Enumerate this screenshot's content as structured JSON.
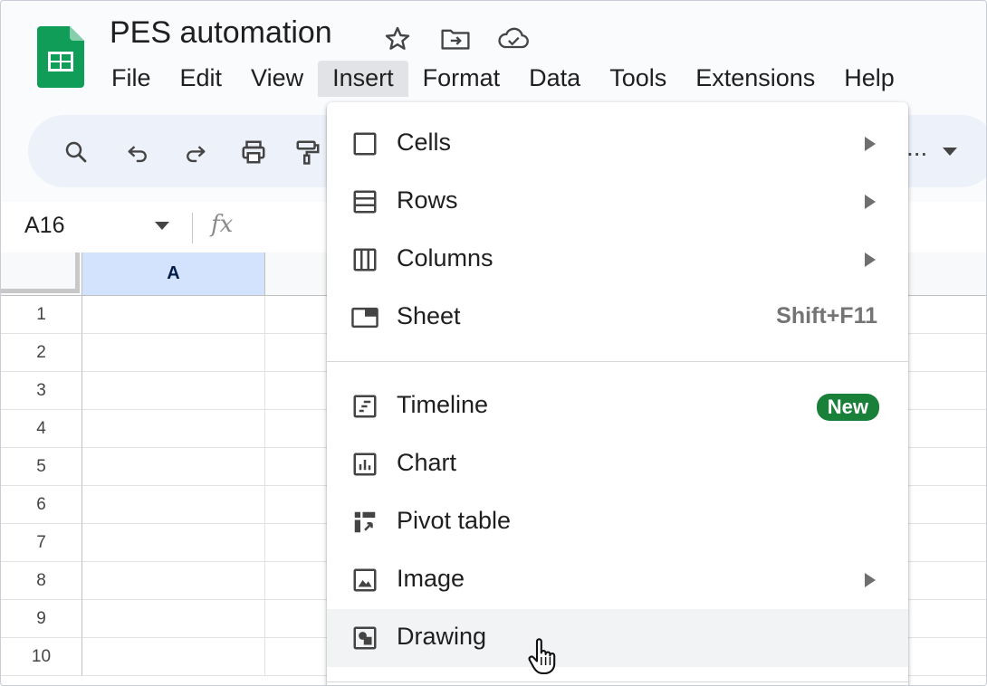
{
  "header": {
    "title": "PES automation",
    "icons": [
      "star-icon",
      "move-to-folder-icon",
      "cloud-saved-icon"
    ]
  },
  "menubar": {
    "items": [
      {
        "label": "File"
      },
      {
        "label": "Edit"
      },
      {
        "label": "View"
      },
      {
        "label": "Insert",
        "active": true
      },
      {
        "label": "Format"
      },
      {
        "label": "Data"
      },
      {
        "label": "Tools"
      },
      {
        "label": "Extensions"
      },
      {
        "label": "Help"
      }
    ]
  },
  "toolbar": {
    "icons": [
      "search-icon",
      "undo-icon",
      "redo-icon",
      "print-icon",
      "paint-format-icon"
    ],
    "overflow": "..."
  },
  "formula_bar": {
    "cell_ref": "A16",
    "fx": "fx"
  },
  "grid": {
    "columns": [
      "A"
    ],
    "rows": [
      "1",
      "2",
      "3",
      "4",
      "5",
      "6",
      "7",
      "8",
      "9",
      "10"
    ]
  },
  "insert_menu": {
    "items": [
      {
        "label": "Cells",
        "icon": "cells-icon",
        "submenu": true
      },
      {
        "label": "Rows",
        "icon": "rows-icon",
        "submenu": true
      },
      {
        "label": "Columns",
        "icon": "columns-icon",
        "submenu": true
      },
      {
        "label": "Sheet",
        "icon": "sheet-icon",
        "shortcut": "Shift+F11"
      },
      {
        "label": "Timeline",
        "icon": "timeline-icon",
        "badge": "New"
      },
      {
        "label": "Chart",
        "icon": "chart-icon"
      },
      {
        "label": "Pivot table",
        "icon": "pivot-table-icon"
      },
      {
        "label": "Image",
        "icon": "image-icon",
        "submenu": true
      },
      {
        "label": "Drawing",
        "icon": "drawing-icon",
        "hovered": true
      }
    ]
  },
  "colors": {
    "accent": "#0b57d0",
    "badge_green": "#188038",
    "logo_green": "#0f9d58",
    "selected_col": "#d3e3fd"
  }
}
